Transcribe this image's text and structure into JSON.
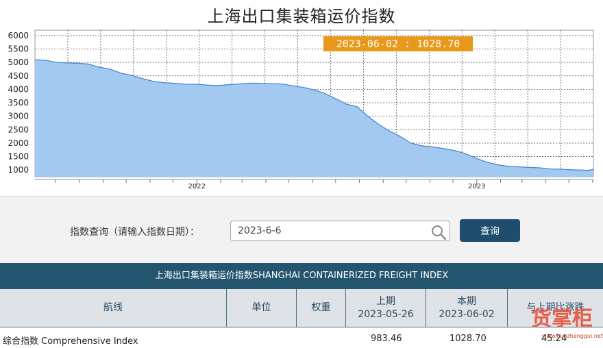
{
  "chart": {
    "title": "上海出口集装箱运价指数",
    "tooltip": "2023-06-02 : 1028.70"
  },
  "chart_data": {
    "type": "area",
    "title": "上海出口集装箱运价指数",
    "ylim": [
      750,
      6200
    ],
    "yticks": [
      1000,
      1500,
      2000,
      2500,
      3000,
      3500,
      4000,
      4500,
      5000,
      5500,
      6000
    ],
    "xlim": [
      "2021-06-04",
      "2023-06-02"
    ],
    "xtick_labels": [
      "2022",
      "2023"
    ],
    "grid": true,
    "fill_color": "#a3c9f0",
    "line_color": "#4a88cc",
    "points": [
      [
        "2021-06-04",
        5100
      ],
      [
        "2021-06-18",
        5080
      ],
      [
        "2021-07-02",
        5000
      ],
      [
        "2021-07-16",
        4980
      ],
      [
        "2021-07-30",
        4970
      ],
      [
        "2021-08-13",
        4940
      ],
      [
        "2021-08-27",
        4820
      ],
      [
        "2021-09-10",
        4750
      ],
      [
        "2021-09-24",
        4600
      ],
      [
        "2021-10-08",
        4520
      ],
      [
        "2021-10-22",
        4400
      ],
      [
        "2021-11-05",
        4300
      ],
      [
        "2021-11-19",
        4250
      ],
      [
        "2021-12-03",
        4220
      ],
      [
        "2021-12-17",
        4190
      ],
      [
        "2021-12-31",
        4190
      ],
      [
        "2022-01-14",
        4160
      ],
      [
        "2022-01-28",
        4140
      ],
      [
        "2022-02-11",
        4170
      ],
      [
        "2022-02-25",
        4200
      ],
      [
        "2022-03-11",
        4230
      ],
      [
        "2022-03-25",
        4220
      ],
      [
        "2022-04-08",
        4210
      ],
      [
        "2022-04-22",
        4200
      ],
      [
        "2022-05-06",
        4130
      ],
      [
        "2022-05-20",
        4070
      ],
      [
        "2022-06-03",
        3980
      ],
      [
        "2022-06-17",
        3850
      ],
      [
        "2022-07-01",
        3650
      ],
      [
        "2022-07-15",
        3450
      ],
      [
        "2022-07-29",
        3350
      ],
      [
        "2022-08-12",
        3000
      ],
      [
        "2022-08-26",
        2700
      ],
      [
        "2022-09-09",
        2450
      ],
      [
        "2022-09-23",
        2250
      ],
      [
        "2022-10-07",
        2000
      ],
      [
        "2022-10-21",
        1900
      ],
      [
        "2022-11-04",
        1860
      ],
      [
        "2022-11-18",
        1800
      ],
      [
        "2022-12-02",
        1730
      ],
      [
        "2022-12-16",
        1620
      ],
      [
        "2022-12-30",
        1450
      ],
      [
        "2023-01-13",
        1300
      ],
      [
        "2023-01-27",
        1200
      ],
      [
        "2023-02-10",
        1140
      ],
      [
        "2023-02-24",
        1120
      ],
      [
        "2023-03-10",
        1100
      ],
      [
        "2023-03-24",
        1080
      ],
      [
        "2023-04-07",
        1040
      ],
      [
        "2023-04-21",
        1030
      ],
      [
        "2023-05-05",
        1010
      ],
      [
        "2023-05-19",
        995
      ],
      [
        "2023-05-26",
        983.46
      ],
      [
        "2023-06-02",
        1028.7
      ]
    ]
  },
  "query": {
    "label": "指数查询（请输入指数日期）：",
    "input_value": "2023-6-6",
    "button_label": "查询"
  },
  "table": {
    "title": "上海出口集装箱运价指数SHANGHAI CONTAINERIZED FREIGHT INDEX",
    "headers": {
      "route": "航线",
      "unit": "单位",
      "weight": "权重",
      "prev_label": "上期",
      "prev_date": "2023-05-26",
      "curr_label": "本期",
      "curr_date": "2023-06-02",
      "change_label": "与上期比涨跌"
    },
    "rows": [
      {
        "route": "综合指数 Comprehensive Index",
        "unit": "",
        "weight": "",
        "prev": "983.46",
        "curr": "1028.70",
        "change": "45.24"
      }
    ]
  },
  "watermark": {
    "text": "货掌柜",
    "url": "www.huozhanggui.net"
  }
}
